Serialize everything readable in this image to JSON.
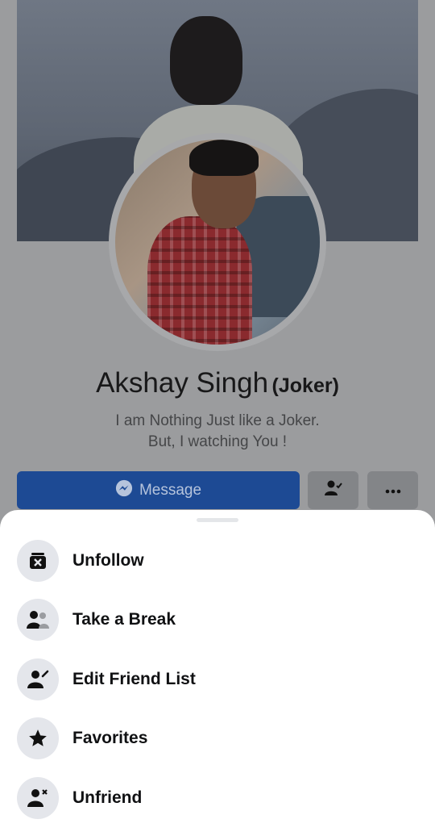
{
  "profile": {
    "name": "Akshay Singh",
    "nickname": "(Joker)",
    "bio_line1": "I am Nothing Just like a Joker.",
    "bio_line2": "But, I watching You !"
  },
  "actions": {
    "message_label": "Message",
    "message_icon": "messenger-icon",
    "friend_icon": "friends-check-icon",
    "more_icon": "more-dots-icon"
  },
  "sheet": {
    "items": [
      {
        "label": "Unfollow",
        "icon": "unfollow-icon"
      },
      {
        "label": "Take a Break",
        "icon": "take-a-break-icon"
      },
      {
        "label": "Edit Friend List",
        "icon": "edit-friend-icon"
      },
      {
        "label": "Favorites",
        "icon": "star-icon"
      },
      {
        "label": "Unfriend",
        "icon": "unfriend-icon"
      }
    ]
  },
  "colors": {
    "message_button": "#1d4a94",
    "sheet_bg": "#ffffff",
    "icon_circle": "#e4e6eb"
  }
}
